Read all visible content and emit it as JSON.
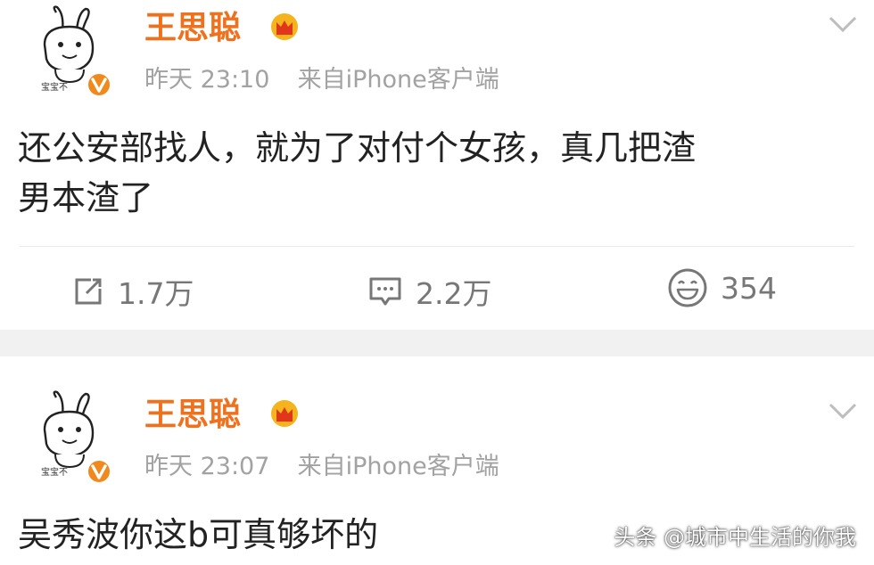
{
  "posts": [
    {
      "username": "王思聪",
      "time": "昨天 23:10",
      "source": "来自iPhone客户端",
      "content_line1": "还公安部找人，就为了对付个女孩，真几把渣",
      "content_line2": "男本渣了",
      "avatar_badge_text": "宝宝不",
      "actions": {
        "repost": "1.7万",
        "comment": "2.2万",
        "like": "354"
      }
    },
    {
      "username": "王思聪",
      "time": "昨天 23:07",
      "source": "来自iPhone客户端",
      "content_line1": "吴秀波你这b可真够坏的",
      "avatar_badge_text": "宝宝不"
    }
  ],
  "watermark": "头条 @城市中生活的你我",
  "colors": {
    "username": "#f0711d",
    "verified_badge": "#f08a1c",
    "meta": "#a2a2a2",
    "separator": "#f1f1f1"
  },
  "icons": [
    "crown-icon",
    "verified-v-icon",
    "chevron-down-icon",
    "repost-icon",
    "comment-icon",
    "like-smiley-icon"
  ]
}
